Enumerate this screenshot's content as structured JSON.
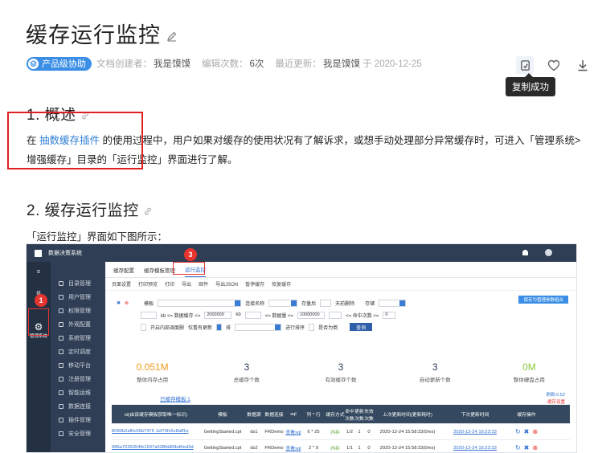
{
  "page": {
    "title": "缓存运行监控",
    "badge": "产品级协助",
    "meta": [
      {
        "label": "文档创建者：",
        "value": "我是馍馍"
      },
      {
        "label": "编辑次数：",
        "value": "6次"
      },
      {
        "label": "最近更新：",
        "value": "我是馍馍",
        "suffix": "于 2020-12-25"
      }
    ],
    "tooltip": "复制成功"
  },
  "section1": {
    "heading": "1. 概述",
    "text_a": "在 ",
    "link": "抽数缓存插件",
    "text_b": " 的使用过程中，用户如果对缓存的使用状况有了解诉求，或想手动处理部分异常缓存时，可进入「管理系统> 增强缓存」目录的「运行监控」界面进行了解。"
  },
  "section2": {
    "heading": "2. 缓存运行监控",
    "caption": "「运行监控」界面如下图所示："
  },
  "screenshot": {
    "app_title": "数据决策系统",
    "side_label": "管理系统",
    "menu": [
      "目录管理",
      "用户管理",
      "权限管理",
      "外观配置",
      "系统管理",
      "定时调度",
      "移动平台",
      "注册管理",
      "智能运维",
      "数据连接",
      "插件管理",
      "安全管理"
    ],
    "tabs": [
      "缓存配置",
      "缓存模板管理",
      "运行监控"
    ],
    "toolbar": [
      "页面设置",
      "打印预览",
      "打印",
      "导出",
      "邮件",
      "导出JSON",
      "暂停缓存",
      "恢复缓存"
    ],
    "save_button": "保存为管理参数组合",
    "filters": {
      "template": "模板",
      "connection": "连接名称",
      "recent": "存量后",
      "recent_unit": "天前删除",
      "status": "存储",
      "kb_from": "kb <= 数据缓存 <=",
      "kb_value": "2000000",
      "kb_unit": "kb",
      "count_from": "<= 数据量 <=",
      "count_value": "10000000",
      "hit": "<= 命中次数 <=",
      "hit_value": "0",
      "check_a": "开启内部调度删",
      "check_b": "仅看有更新",
      "sort": "排",
      "sort_order": "进行排序",
      "desc": "是否为倒",
      "query": "查询"
    },
    "stats": [
      {
        "value": "0.051M",
        "label": "整体内存占用",
        "color": "#f39a1e"
      },
      {
        "value": "3",
        "label": "总缓存个数",
        "color": "#2a3a55"
      },
      {
        "value": "3",
        "label": "有效缓存个数",
        "color": "#2a3a55"
      },
      {
        "value": "3",
        "label": "自动更新个数",
        "color": "#2a3a55"
      },
      {
        "value": "0M",
        "label": "整体硬盘占用",
        "color": "#8acb3c"
      }
    ],
    "table_title": "已缓存模板:1",
    "right_note": "缓存设置",
    "refresh_time": "刷新:0.52",
    "columns": [
      "id(由该缓存模板获取唯一标识)",
      "模板",
      "数据源",
      "数据连接",
      "sql",
      "列 * 行",
      "缓存方式",
      "命中次数",
      "更新次数",
      "失效次数",
      "上次更新时间(更新耗时)",
      "下次更新时间",
      "缓存操作"
    ],
    "rows": [
      {
        "id": "8090b2af0c56b7475 1ef70fc6c8aff1e",
        "tpl": "GettingStarted.cpt",
        "ds": "ds1",
        "conn": "FRDemo",
        "sql": "查看sql",
        "dims": "6 * 25",
        "mode": "内存",
        "hit": "1/2",
        "upd": "1",
        "fail": "0",
        "last": "2020-12-24 15:58:33(0ms)",
        "next": "2020-12-24 16:23:33"
      },
      {
        "id": "986a7635354fe1597a038bb80bd0ed3d",
        "tpl": "GettingStarted.cpt",
        "ds": "ds2",
        "conn": "FRDemo",
        "sql": "查看sql",
        "dims": "2 * 9",
        "mode": "内存",
        "hit": "1/1",
        "upd": "1",
        "fail": "0",
        "last": "2020-12-24 15:58:33(0ms)",
        "next": "2020-12-24 16:23:33"
      },
      {
        "id": "0033c0313ab450d916d2781cce20c4ab",
        "tpl": "GettingStarted.cpt",
        "ds": "全模板数据集",
        "conn": "FRDemo",
        "sql": "查看sql",
        "dims": "6 * 45",
        "mode": "内存",
        "hit": "1/1",
        "upd": "1",
        "fail": "0",
        "last": "2020-12-24 15:58:31(1ms)",
        "next": "2020-12-24 16:23:31"
      }
    ],
    "markers": [
      "1",
      "2",
      "3"
    ]
  },
  "colors": {
    "accent": "#3a8ee6",
    "link": "#2f7fd6",
    "highlight_box": "#e02020"
  }
}
